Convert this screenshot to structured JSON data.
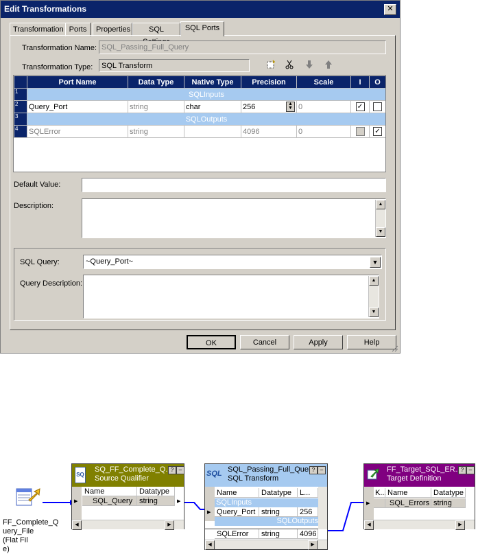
{
  "dialog": {
    "title": "Edit Transformations",
    "close_glyph": "✕",
    "tabs": [
      "Transformation",
      "Ports",
      "Properties",
      "SQL Settings",
      "SQL Ports"
    ],
    "active_tab": "SQL Ports",
    "transformation_name_label": "Transformation Name:",
    "transformation_name_value": "SQL_Passing_Full_Query",
    "transformation_type_label": "Transformation Type:",
    "transformation_type_value": "SQL Transform",
    "toolbar_icons": [
      "new-port-icon",
      "cut-icon",
      "move-down-icon",
      "move-up-icon"
    ],
    "grid": {
      "columns": [
        "Port Name",
        "Data Type",
        "Native Type",
        "Precision",
        "Scale",
        "I",
        "O"
      ],
      "row_numbers": [
        "1",
        "2",
        "3",
        "4"
      ],
      "group_sqlinputs": "SQLInputs",
      "group_sqloutputs": "SQLOutputs",
      "row2": {
        "name": "Query_Port",
        "datatype": "string",
        "native": "char",
        "precision": "256",
        "scale": "0",
        "input": true,
        "output": false
      },
      "row4": {
        "name": "SQLError",
        "datatype": "string",
        "native": "",
        "precision": "4096",
        "scale": "0",
        "input": false,
        "output": true
      }
    },
    "default_value_label": "Default Value:",
    "default_value": "",
    "description_label": "Description:",
    "description_value": "",
    "sql_query_label": "SQL Query:",
    "sql_query_value": "~Query_Port~",
    "query_description_label": "Query Description:",
    "query_description_value": "",
    "buttons": {
      "ok": "OK",
      "cancel": "Cancel",
      "apply": "Apply",
      "help": "Help"
    }
  },
  "mapping": {
    "source_file": {
      "label": "FF_Complete_Q\nuery_File (Flat Fil\ne)"
    },
    "source_qualifier": {
      "title": "SQ_FF_Complete_Q...",
      "subtitle": "Source Qualifier",
      "header_color": "#808000",
      "columns": [
        "Name",
        "Datatype"
      ],
      "rows": [
        {
          "name": "SQL_Query",
          "datatype": "string"
        }
      ]
    },
    "sql_transform": {
      "title": "SQL_Passing_Full_Query",
      "subtitle": "SQL Transform",
      "header_color": "#a6caf0",
      "columns": [
        "Name",
        "Datatype",
        "L..."
      ],
      "group_inputs": "SQLInputs",
      "group_outputs": "SQLOutputs",
      "input_row": {
        "name": "Query_Port",
        "datatype": "string",
        "length": "256"
      },
      "output_row": {
        "name": "SQLError",
        "datatype": "string",
        "length": "4096"
      }
    },
    "target": {
      "title": "FF_Target_SQL_ER...",
      "subtitle": "Target Definition",
      "header_color": "#800080",
      "columns": [
        "K...",
        "Name",
        "Datatype"
      ],
      "rows": [
        {
          "name": "SQL_Errors",
          "datatype": "string"
        }
      ]
    },
    "node_button_help": "?",
    "node_button_min": "–"
  }
}
